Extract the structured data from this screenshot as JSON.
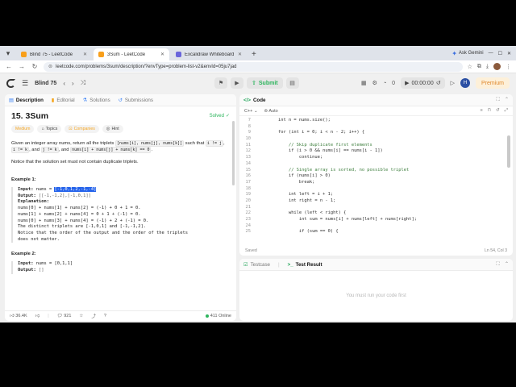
{
  "browser": {
    "tabs": [
      {
        "title": "Blind 75 - LeetCode",
        "active": false,
        "icon": "leetcode"
      },
      {
        "title": "3Sum - LeetCode",
        "active": true,
        "icon": "leetcode"
      },
      {
        "title": "Excalidraw Whiteboard",
        "active": false,
        "icon": "excalidraw"
      }
    ],
    "new_tab": "+",
    "ask_gemini": "Ask Gemini",
    "url": "leetcode.com/problems/3sum/description/?envType=problem-list-v2&envId=05ju7jad"
  },
  "lc_nav": {
    "list_name": "Blind 75",
    "submit_label": "Submit",
    "timer": "00:00:00",
    "streak": "0",
    "avatar_initial": "H",
    "premium": "Premium"
  },
  "left": {
    "tabs": [
      {
        "label": "Description",
        "icon": "doc-icon",
        "color": "#3b82f6",
        "active": true
      },
      {
        "label": "Editorial",
        "icon": "book-icon",
        "color": "#f59e0b",
        "active": false
      },
      {
        "label": "Solutions",
        "icon": "flask-icon",
        "color": "#3b82f6",
        "active": false
      },
      {
        "label": "Submissions",
        "icon": "history-icon",
        "color": "#3b82f6",
        "active": false
      }
    ],
    "title": "15. 3Sum",
    "solved": "Solved",
    "pills": {
      "difficulty": "Medium",
      "topics": "Topics",
      "companies": "Companies",
      "hint": "Hint"
    },
    "statement": {
      "p1_a": "Given an integer array nums, return all the triplets ",
      "p1_code1": "[nums[i], nums[j], nums[k]]",
      "p1_b": " such that ",
      "p1_code2": "i != j",
      "p1_c": ", ",
      "p1_code3": "i != k",
      "p1_d": ", and ",
      "p1_code4": "j != k",
      "p1_e": ", and ",
      "p1_code5": "nums[i] + nums[j] + nums[k] == 0",
      "p1_f": ".",
      "p2": "Notice that the solution set must not contain duplicate triplets."
    },
    "example1": {
      "heading": "Example 1:",
      "input_label": "Input:",
      "input_prefix": " nums = ",
      "input_value": "[-1,0,1,2,-1,-4]",
      "output_label": "Output:",
      "output_value": " [[-1,-1,2],[-1,0,1]]",
      "explanation_label": "Explanation:",
      "lines": [
        "nums[0] + nums[1] + nums[2] = (-1) + 0 + 1 = 0.",
        "nums[1] + nums[2] + nums[4] = 0 + 1 + (-1) = 0.",
        "nums[0] + nums[3] + nums[4] = (-1) + 2 + (-1) = 0.",
        "The distinct triplets are [-1,0,1] and [-1,-1,2].",
        "Notice that the order of the output and the order of the triplets",
        "does not matter."
      ]
    },
    "example2": {
      "heading": "Example 2:",
      "input_label": "Input:",
      "input_value": " nums = [0,1,1]",
      "output_label": "Output:",
      "output_value": " []"
    },
    "footer": {
      "likes": "36.4K",
      "comments": "921",
      "online": "411 Online"
    }
  },
  "code": {
    "header": "Code",
    "language": "C++",
    "mode": "Auto",
    "lines": [
      {
        "n": "7",
        "t": "        int n = nums.size();"
      },
      {
        "n": "8",
        "t": ""
      },
      {
        "n": "9",
        "t": "        for (int i = 0; i < n - 2; i++) {"
      },
      {
        "n": "10",
        "t": ""
      },
      {
        "n": "11",
        "t": "            // Skip duplicate first elements"
      },
      {
        "n": "12",
        "t": "            if (i > 0 && nums[i] == nums[i - 1])"
      },
      {
        "n": "13",
        "t": "                continue;"
      },
      {
        "n": "14",
        "t": ""
      },
      {
        "n": "15",
        "t": "            // Single array is sorted, no possible triplet"
      },
      {
        "n": "16",
        "t": "            if (nums[i] > 0)"
      },
      {
        "n": "17",
        "t": "                break;"
      },
      {
        "n": "18",
        "t": ""
      },
      {
        "n": "19",
        "t": "            int left = i + 1;"
      },
      {
        "n": "20",
        "t": "            int right = n - 1;"
      },
      {
        "n": "21",
        "t": ""
      },
      {
        "n": "22",
        "t": "            while (left < right) {"
      },
      {
        "n": "23",
        "t": "                int sum = nums[i] + nums[left] + nums[right];"
      },
      {
        "n": "24",
        "t": ""
      },
      {
        "n": "25",
        "t": "                if (sum == 0) {"
      }
    ],
    "saved": "Saved",
    "cursor": "Ln 54, Col 3"
  },
  "test": {
    "tab1": "Testcase",
    "tab2": "Test Result",
    "empty": "You must run your code first"
  }
}
